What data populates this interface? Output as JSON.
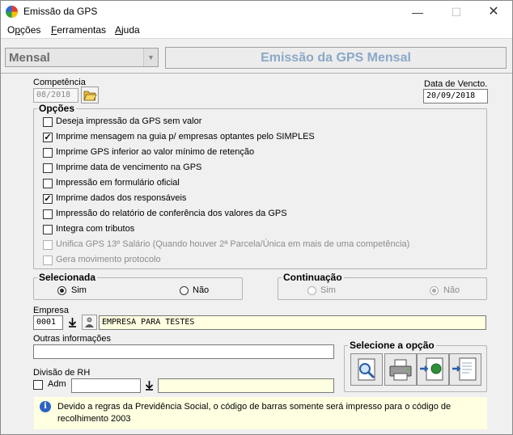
{
  "window": {
    "title": "Emissão da GPS"
  },
  "menu": {
    "items": [
      "Opções",
      "Ferramentas",
      "Ajuda"
    ]
  },
  "header": {
    "period_select": "Mensal",
    "banner": "Emissão da GPS Mensal"
  },
  "competencia": {
    "label": "Competência",
    "value": "08/2018"
  },
  "vencimento": {
    "label": "Data de Vencto.",
    "value": "20/09/2018"
  },
  "opcoes": {
    "title": "Opções",
    "items": [
      {
        "label": "Deseja impressão da GPS sem valor",
        "checked": false,
        "enabled": true
      },
      {
        "label": "Imprime mensagem na guia p/ empresas optantes pelo SIMPLES",
        "checked": true,
        "enabled": true
      },
      {
        "label": "Imprime GPS inferior ao valor mínimo de retenção",
        "checked": false,
        "enabled": true
      },
      {
        "label": "Imprime data de vencimento na GPS",
        "checked": false,
        "enabled": true
      },
      {
        "label": "Impressão em formulário oficial",
        "checked": false,
        "enabled": true
      },
      {
        "label": "Imprime dados dos responsáveis",
        "checked": true,
        "enabled": true
      },
      {
        "label": "Impressão do relatório de conferência dos valores da GPS",
        "checked": false,
        "enabled": true
      },
      {
        "label": "Integra com tributos",
        "checked": false,
        "enabled": true
      },
      {
        "label": "Unifica GPS 13º Salário (Quando houver 2ª Parcela/Única em mais de uma competência)",
        "checked": false,
        "enabled": false
      },
      {
        "label": "Gera movimento protocolo",
        "checked": false,
        "enabled": false
      }
    ]
  },
  "selecionada": {
    "title": "Selecionada",
    "sim": "Sim",
    "nao": "Não",
    "selected": "sim"
  },
  "continuacao": {
    "title": "Continuação",
    "sim": "Sim",
    "nao": "Não",
    "selected": "nao"
  },
  "empresa": {
    "label": "Empresa",
    "code": "0001",
    "name": "EMPRESA PARA TESTES"
  },
  "outras": {
    "label": "Outras informações",
    "value": ""
  },
  "divisao": {
    "label": "Divisão de RH",
    "adm_label": "Adm",
    "code": "",
    "name": ""
  },
  "selecione": {
    "title": "Selecione a opção"
  },
  "info": {
    "text": "Devido a regras da Previdência Social, o código de barras somente será impresso para o código de recolhimento 2003"
  },
  "icons": {
    "app": "gps-app-icon",
    "folder": "open-folder-icon",
    "download": "download-arrow-icon",
    "search_person": "person-search-icon",
    "preview": "magnifier-preview-icon",
    "printer": "printer-icon",
    "export": "export-globe-icon",
    "export_file": "export-file-icon",
    "info": "info-icon"
  }
}
